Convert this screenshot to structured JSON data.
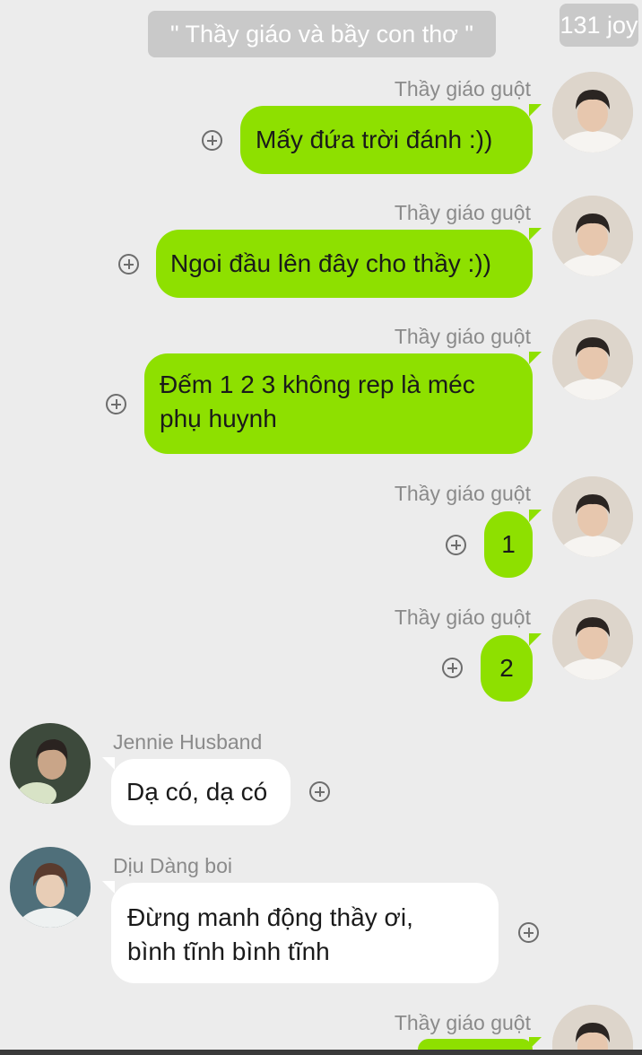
{
  "header": {
    "chat_title": "\" Thầy giáo và bầy con thơ \"",
    "watermark": "131 joy"
  },
  "messages": [
    {
      "sender": "Thầy giáo guột",
      "side": "right",
      "text": "Mấy đứa trời đánh :))"
    },
    {
      "sender": "Thầy giáo guột",
      "side": "right",
      "text": "Ngoi đầu lên đây cho thầy :))"
    },
    {
      "sender": "Thầy giáo guột",
      "side": "right",
      "text_lines": [
        "Đếm 1 2 3 không rep là méc",
        "phụ huynh"
      ]
    },
    {
      "sender": "Thầy giáo guột",
      "side": "right",
      "text": "1"
    },
    {
      "sender": "Thầy giáo guột",
      "side": "right",
      "text": "2"
    },
    {
      "sender": "Jennie Husband",
      "side": "left",
      "text": "Dạ có, dạ có"
    },
    {
      "sender": "Dịu Dàng boi",
      "side": "left",
      "text_lines": [
        "Đừng manh động thầy ơi,",
        "bình tĩnh bình tĩnh"
      ]
    },
    {
      "sender": "Thầy giáo guột",
      "side": "right",
      "text": ""
    }
  ],
  "icons": {
    "add_reaction": "circle-plus-icon",
    "avatar_teacher": "avatar-teacher",
    "avatar_jennie": "avatar-jennie-husband",
    "avatar_diu": "avatar-diu-dang-boi"
  },
  "colors": {
    "background": "#ececec",
    "own_bubble": "#8ee000",
    "other_bubble": "#ffffff",
    "sender_name": "#8a8a8a",
    "title_pill": "#c9c9c9"
  }
}
